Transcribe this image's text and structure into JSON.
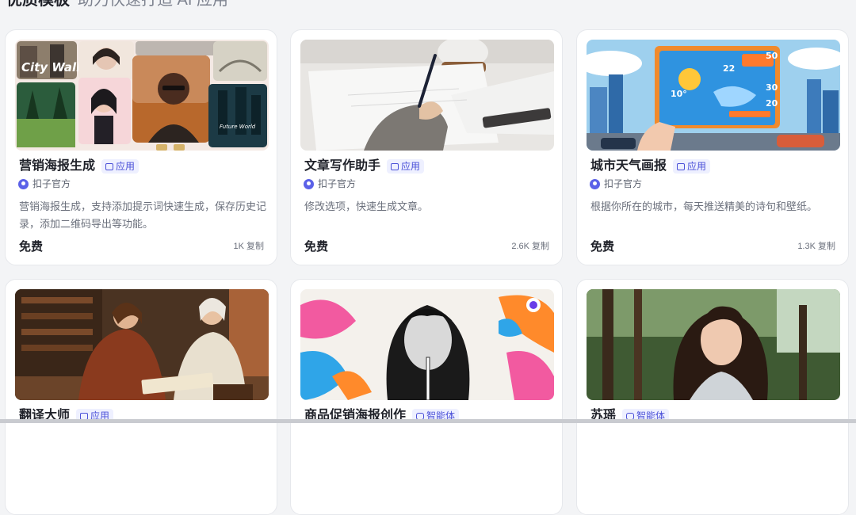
{
  "section": {
    "title": "优质模板",
    "subtitle": "助力快速打造 AI 应用"
  },
  "cards": [
    {
      "title": "营销海报生成",
      "tag": "应用",
      "tag_icon": "app-icon",
      "author": "扣子官方",
      "description": "营销海报生成，支持添加提示词快速生成，保存历史记录，添加二维码导出等功能。",
      "price": "免费",
      "copies": "1K 复制",
      "thumb_texts": [
        "City Walk",
        "Future World"
      ]
    },
    {
      "title": "文章写作助手",
      "tag": "应用",
      "tag_icon": "app-icon",
      "author": "扣子官方",
      "description": "修改选项，快速生成文章。",
      "price": "免费",
      "copies": "2.6K 复制"
    },
    {
      "title": "城市天气画报",
      "tag": "应用",
      "tag_icon": "app-icon",
      "author": "扣子官方",
      "description": "根据你所在的城市，每天推送精美的诗句和壁纸。",
      "price": "免费",
      "copies": "1.3K 复制",
      "thumb_texts": [
        "50",
        "22",
        "30",
        "20",
        "10°"
      ]
    },
    {
      "title": "翻译大师",
      "tag": "应用",
      "tag_icon": "app-icon"
    },
    {
      "title": "商品促销海报创作",
      "tag": "智能体",
      "tag_icon": "bot-icon"
    },
    {
      "title": "苏瑶",
      "tag": "智能体",
      "tag_icon": "bot-icon"
    }
  ],
  "colors": {
    "accent": "#4a50d8",
    "tag_bg": "#eef0ff",
    "page_bg": "#f3f4f6"
  }
}
